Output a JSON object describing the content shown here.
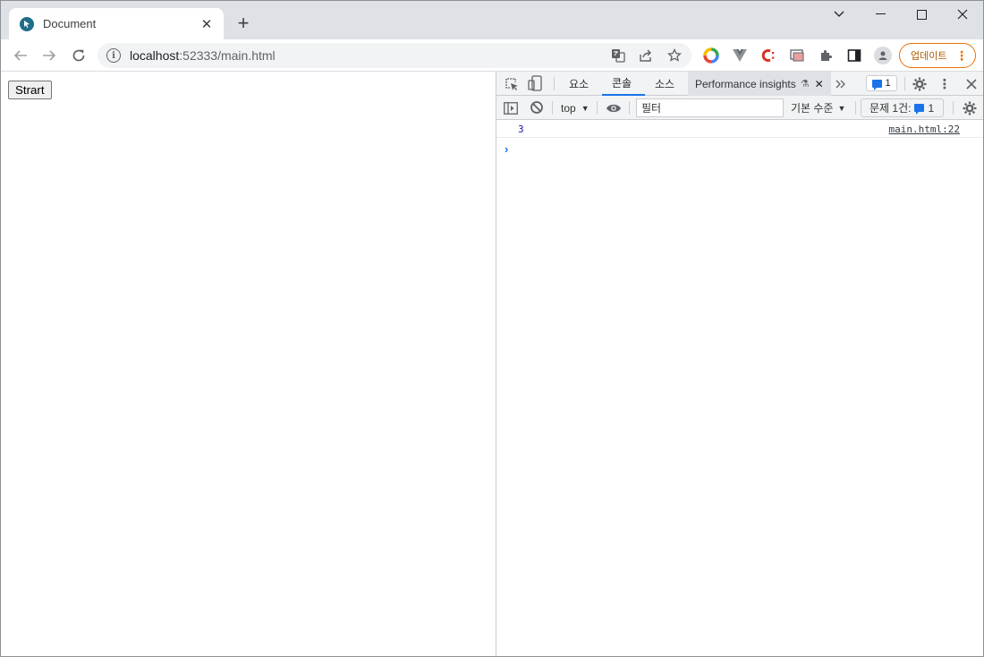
{
  "browser": {
    "tab": {
      "title": "Document",
      "favicon": "pointer-favicon-icon",
      "close": "✕"
    },
    "new_tab": "+",
    "address": {
      "host": "localhost",
      "rest": ":52333/main.html"
    },
    "update_button": "업데이트",
    "accent_color": "#e8710a"
  },
  "page": {
    "start_button": "Strart"
  },
  "devtools": {
    "tabs": {
      "elements": "요소",
      "console": "콘솔",
      "sources": "소스",
      "performance_insights": "Performance insights"
    },
    "issue_badge_count": "1",
    "context": "top",
    "filter_placeholder": "필터",
    "levels": "기본 수준",
    "issues_label": "문제 1건:",
    "issues_count": "1",
    "console_log": {
      "value": "3",
      "source": "main.html:22"
    },
    "prompt": "›"
  }
}
